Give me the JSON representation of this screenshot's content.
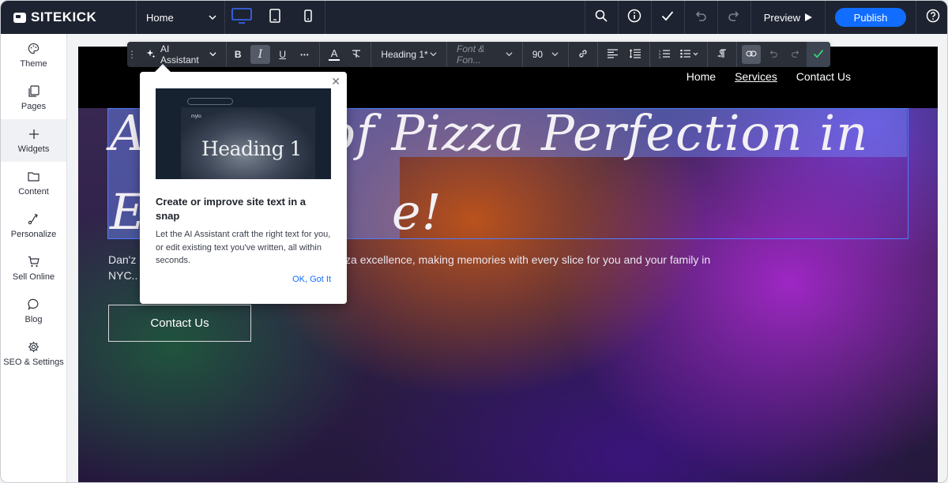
{
  "topbar": {
    "brand": "SITEKICK",
    "page_select": "Home",
    "preview_label": "Preview",
    "publish_label": "Publish",
    "icons": [
      "desktop-icon",
      "tablet-icon",
      "mobile-icon",
      "search-icon",
      "info-icon",
      "check-icon",
      "undo-icon",
      "redo-icon",
      "play-icon",
      "help-icon"
    ]
  },
  "sidebar": {
    "items": [
      {
        "label": "Theme",
        "icon": "palette-icon"
      },
      {
        "label": "Pages",
        "icon": "pages-icon"
      },
      {
        "label": "Widgets",
        "icon": "plus-icon"
      },
      {
        "label": "Content",
        "icon": "folder-icon"
      },
      {
        "label": "Personalize",
        "icon": "personalize-icon"
      },
      {
        "label": "Sell Online",
        "icon": "cart-icon"
      },
      {
        "label": "Blog",
        "icon": "chat-icon"
      },
      {
        "label": "SEO & Settings",
        "icon": "gear-icon"
      }
    ]
  },
  "toolbar": {
    "ai_label": "AI Assistant",
    "bold": "B",
    "italic": "I",
    "underline": "U",
    "more": "•••",
    "text_color": "A",
    "clear": "T",
    "style_select": "Heading 1*",
    "font_placeholder": "Font & Fon...",
    "size": "90"
  },
  "site": {
    "nav": [
      "Home",
      "Services",
      "Contact Us"
    ],
    "heading": "A Taste of Pizza Perfection in Every Slice!",
    "heading_line1": "A           of Pizza Perfection in",
    "heading_line2": "E               e!",
    "body_left": "Dan'z P",
    "body_right": "pizza excellence, making memories with every slice for you and your family in",
    "body_line2": "NYC..",
    "cta": "Contact Us"
  },
  "popup": {
    "image_heading": "Heading 1",
    "mini_logo": "mylo",
    "title": "Create or improve site text in a snap",
    "description": "Let the AI Assistant craft the right text for you, or edit existing text you've written, all within seconds.",
    "ok_label": "OK, Got It"
  },
  "colors": {
    "topbar": "#1d2330",
    "publish": "#116dff",
    "selection": "#4f7cff",
    "toolbar": "#2b2f38",
    "confirm": "#38d97a"
  }
}
